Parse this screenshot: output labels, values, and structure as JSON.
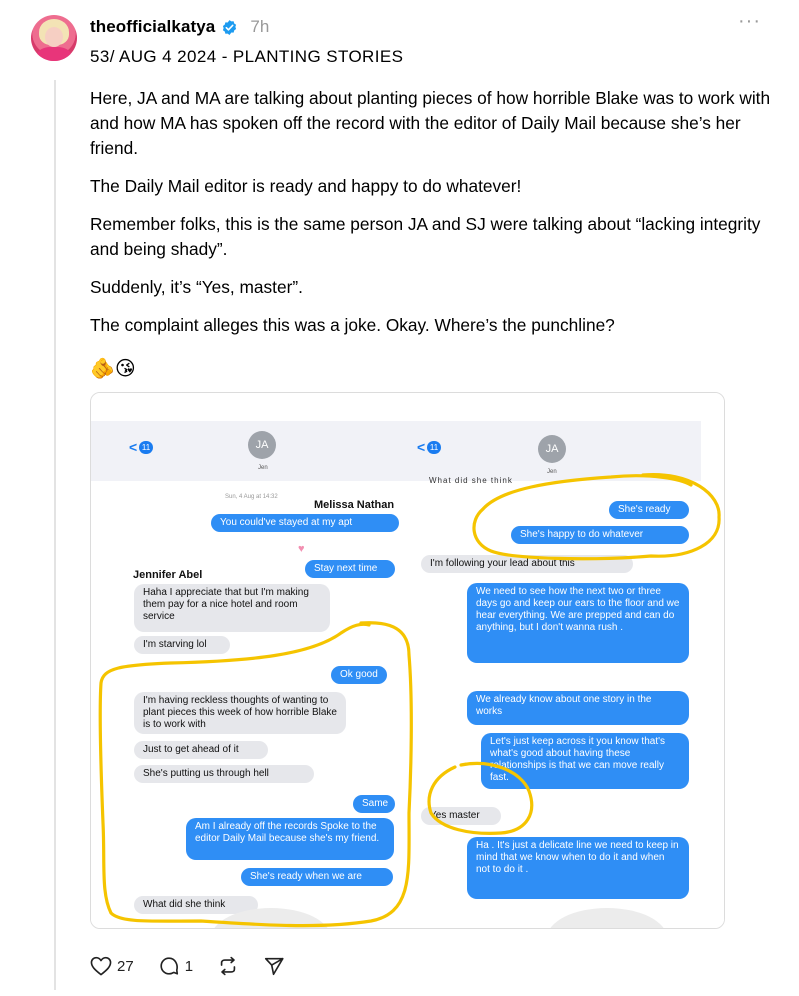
{
  "post": {
    "username": "theofficialkatya",
    "time": "7h",
    "more": "···",
    "title": "53/ AUG 4 2024 - PLANTING STORIES",
    "paragraphs": [
      "Here, JA and MA are talking about planting pieces of how horrible Blake was to work with and how MA has spoken off the record with the editor of Daily Mail because she’s her friend.",
      "The Daily Mail editor is ready and happy to do whatever!",
      "Remember folks, this is the same person JA and SJ were talking about “lacking integrity and being shady”.",
      "Suddenly, it’s “Yes, master”.",
      "The complaint alleges this was a joke. Okay. Where’s the punchline?"
    ],
    "emoji": "🫵😘"
  },
  "screenshot": {
    "left": {
      "back_count": "11",
      "contact_initials": "JA",
      "contact_name": "Jen",
      "timestamp": "Sun, 4 Aug at 14:32",
      "sender_top": "Melissa Nathan",
      "sender_mid": "Jennifer Abel",
      "msgs": {
        "m1": "You could've stayed at my apt",
        "m2": "Stay next time",
        "m3": "Haha I appreciate that but I'm making them pay for a nice hotel and room service",
        "m4": "I'm starving lol",
        "m5": "Ok good",
        "m6": "I'm having reckless thoughts of wanting to plant pieces this week of how horrible Blake is to work with",
        "m7": "Just to get ahead of it",
        "m8": "She's putting us through hell",
        "m9": "Same",
        "m10": "Am I already off the records Spoke to the editor Daily Mail because she's my friend.",
        "m11": "She's ready when we are",
        "m12": "What did she think"
      }
    },
    "right": {
      "back_count": "11",
      "contact_initials": "JA",
      "contact_name": "Jen",
      "cutoff": "What did she think",
      "msgs": {
        "r1": "She's ready",
        "r2": "She's happy to do whatever",
        "r3": "I'm following your lead about this",
        "r4": "We need to see how the next two or three days go and keep our ears to the floor and we hear everything. We are prepped and can do anything, but I don't wanna rush .",
        "r5": "We already know about one story in the works",
        "r6": "Let's just keep across it you know that's what's good about having these relationships is that we can move really fast.",
        "r7": "Yes master",
        "r8": "Ha . It's just a delicate line we need to keep in mind that we know when to do it and when not to do it ."
      }
    },
    "highlight_color": "#f5c400"
  },
  "actions": {
    "likes": "27",
    "replies": "1"
  },
  "colors": {
    "verified": "#1d9bf0",
    "imessage_blue": "#2f8ef5",
    "bubble_gray": "#e6e7eb"
  }
}
